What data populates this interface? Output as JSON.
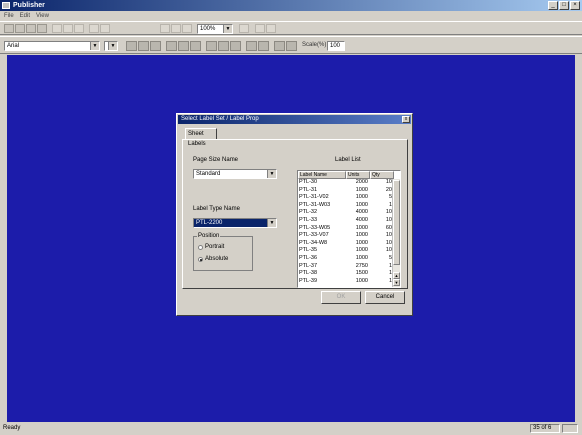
{
  "window": {
    "title": "Publisher"
  },
  "menu": [
    "File",
    "Edit",
    "View"
  ],
  "toolbar": {
    "zoom": "100%",
    "font": "Arial",
    "size_label": "Scale(%)",
    "size_value": "100"
  },
  "status": {
    "left": "Ready",
    "right": "35 of 6"
  },
  "dialog": {
    "title": "Select Label Set / Label Prop",
    "tab": "Sheet Labels",
    "page_setup_label": "Page Size Name",
    "page_setup_value": "Standard",
    "label_type_label": "Label Type Name",
    "label_type_value": "PTL-2200",
    "label_list_label": "Label List",
    "orientation_title": "Position",
    "orientation_options": [
      {
        "label": "Portrait",
        "selected": false
      },
      {
        "label": "Absolute",
        "selected": true
      }
    ],
    "table_headers": [
      "Label Name",
      "Units",
      "Qty"
    ],
    "rows": [
      [
        "PTL-30",
        "2000",
        "10"
      ],
      [
        "PTL-31",
        "1000",
        "20"
      ],
      [
        "PTL-31-V02",
        "1000",
        "5"
      ],
      [
        "PTL-31-W03",
        "1000",
        "1"
      ],
      [
        "PTL-32",
        "4000",
        "10"
      ],
      [
        "PTL-33",
        "4000",
        "10"
      ],
      [
        "PTL-33-W05",
        "1000",
        "60"
      ],
      [
        "PTL-33-V07",
        "1000",
        "10"
      ],
      [
        "PTL-34-W8",
        "1000",
        "10"
      ],
      [
        "PTL-35",
        "1000",
        "10"
      ],
      [
        "PTL-36",
        "1000",
        "5"
      ],
      [
        "PTL-37",
        "2750",
        "1"
      ],
      [
        "PTL-38",
        "1500",
        "1"
      ],
      [
        "PTL-39",
        "1000",
        "1"
      ]
    ],
    "ok_label": "OK",
    "cancel_label": "Cancel"
  }
}
